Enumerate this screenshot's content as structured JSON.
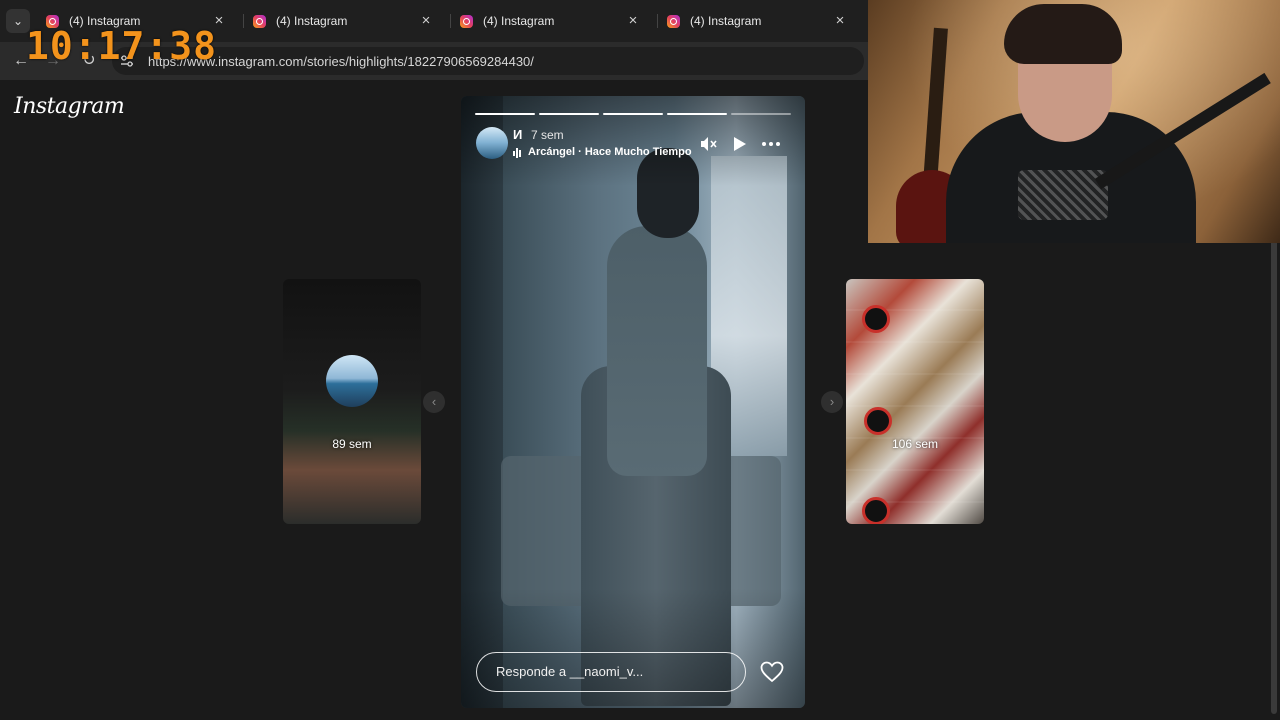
{
  "browser": {
    "tabs": [
      {
        "title": "(4) Instagram"
      },
      {
        "title": "(4) Instagram"
      },
      {
        "title": "(4) Instagram"
      },
      {
        "title": "(4) Instagram"
      }
    ],
    "tab_close_glyph": "×",
    "tab_menu_glyph": "⌄",
    "url": "https://www.instagram.com/stories/highlights/18227906569284430/",
    "nav_icons": [
      "back-arrow-icon",
      "forward-arrow-icon",
      "reload-icon",
      "site-settings-icon"
    ]
  },
  "overlay": {
    "clock": "10:17:38",
    "clock_color": "#f3931c"
  },
  "instagram": {
    "logo": "Instagram",
    "left_story": {
      "time": "89 sem"
    },
    "right_story": {
      "time": "106 sem"
    },
    "story": {
      "username": "И",
      "time": "7 sem",
      "music": "Arcángel · Hace Mucho Tiempo",
      "progress_segments": 5,
      "progress_done": 4,
      "reply_placeholder": "Responde a __naomi_v...",
      "icons": [
        "music-bars-icon",
        "mute-icon",
        "play-icon",
        "more-options-icon",
        "heart-icon"
      ]
    },
    "arrows": {
      "prev": "‹",
      "next": "›"
    }
  }
}
